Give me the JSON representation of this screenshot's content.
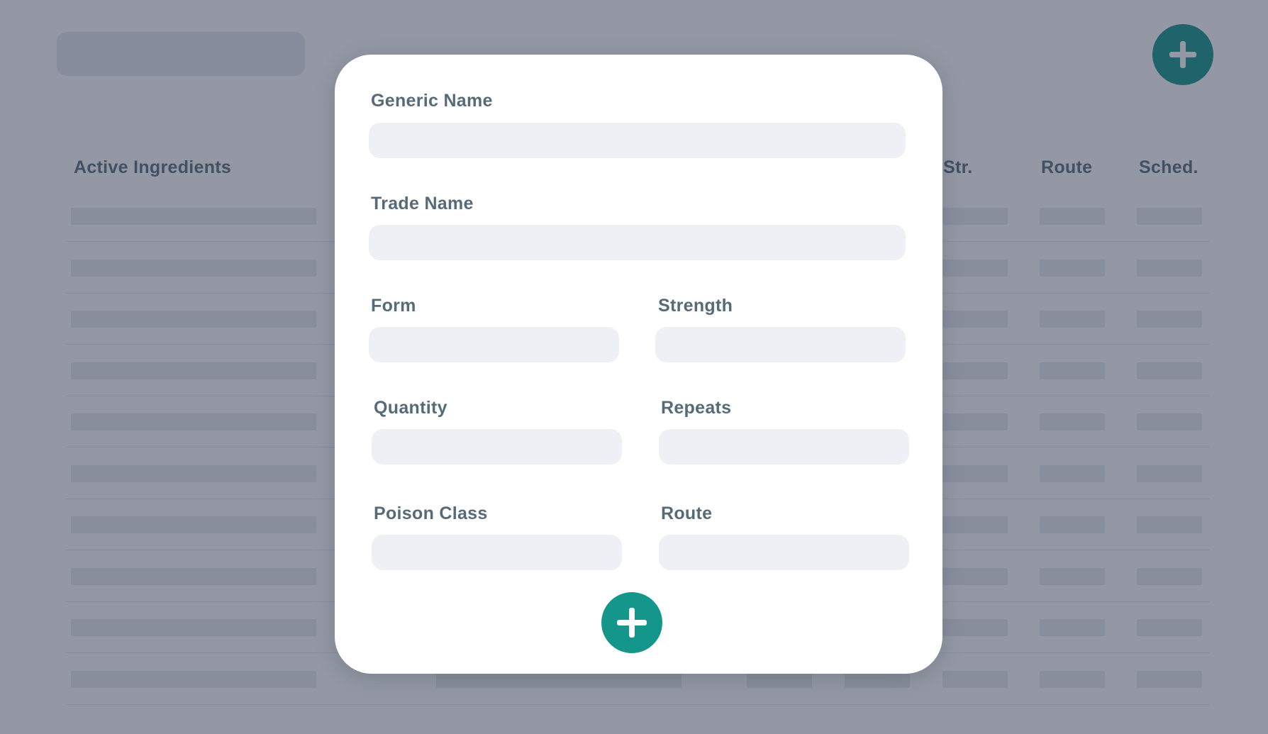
{
  "background": {
    "table": {
      "headers": [
        {
          "key": "active_ingredients",
          "label": "Active Ingredients"
        },
        {
          "key": "strength",
          "label": "Str."
        },
        {
          "key": "route",
          "label": "Route"
        },
        {
          "key": "schedule",
          "label": "Sched."
        }
      ]
    }
  },
  "modal": {
    "fields": {
      "generic_name": {
        "label": "Generic Name",
        "value": ""
      },
      "trade_name": {
        "label": "Trade Name",
        "value": ""
      },
      "form": {
        "label": "Form",
        "value": ""
      },
      "strength": {
        "label": "Strength",
        "value": ""
      },
      "quantity": {
        "label": "Quantity",
        "value": ""
      },
      "repeats": {
        "label": "Repeats",
        "value": ""
      },
      "poison_class": {
        "label": "Poison Class",
        "value": ""
      },
      "route": {
        "label": "Route",
        "value": ""
      }
    },
    "submit_icon": "plus-icon"
  },
  "colors": {
    "accent": "#14968a",
    "overlay": "#273249",
    "input_bg": "#eff0f5",
    "label": "#566b77"
  }
}
